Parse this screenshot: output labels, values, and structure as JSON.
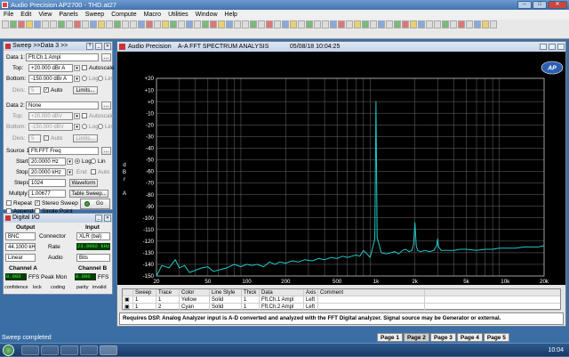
{
  "window": {
    "title": "Audio Precision AP2700 - THD.at27"
  },
  "menu": [
    "File",
    "Edit",
    "View",
    "Panels",
    "Sweep",
    "Compute",
    "Macro",
    "Utilities",
    "Window",
    "Help"
  ],
  "sweep_panel": {
    "title": "Sweep >>Data 3 >>",
    "data1": {
      "label": "Data 1:",
      "value": "Fft.Ch.1 Ampl",
      "top_label": "Top:",
      "top": "+20.000 dBr A",
      "autoscale": "Autoscale",
      "bottom_label": "Bottom:",
      "bottom": "-150.000 dBr A",
      "log": "Log",
      "lin": "Lin",
      "divs_label": "Divs:",
      "divs": "5",
      "auto": "Auto",
      "limits": "Limits..."
    },
    "data2": {
      "label": "Data 2:",
      "value": "None",
      "top_label": "Top:",
      "top": "+20.000 dBV",
      "autoscale": "Autoscale",
      "bottom_label": "Bottom:",
      "bottom": "-150.000 dBV",
      "log": "Log",
      "lin": "Lin",
      "divs_label": "Divs:",
      "divs": "5",
      "auto": "Auto",
      "limits": "Limits..."
    },
    "source1": {
      "label": "Source 1:",
      "value": "Fft.FFT Freq",
      "start_label": "Start:",
      "start": "20.0000 Hz",
      "log": "Log",
      "lin": "Lin",
      "stop_label": "Stop:",
      "stop": "20.0000 kHz",
      "end": "End",
      "auto": "Auto",
      "steps_label": "Steps:",
      "steps": "1024",
      "waveform": "Waveform",
      "multiply_label": "Multply:",
      "multiply": "1.00677",
      "table_sweep": "Table Sweep..."
    },
    "repeat": "Repeat",
    "stereo_sweep": "Stereo Sweep",
    "append": "Append",
    "single_point": "Single Point",
    "go": "Go"
  },
  "digital_io": {
    "title": "Digital I/O",
    "output_label": "Output",
    "input_label": "Input",
    "out_type": "BNC",
    "connector": "Connector",
    "in_type": "XLR (bal)",
    "out_rate": "44.1000 kHz",
    "rate": "Rate",
    "in_rate": "23.0002 kHz",
    "out_audio": "Linear",
    "audio": "Audio",
    "in_audio": "Bits",
    "chA_label": "Channel A",
    "chB_label": "Channel B",
    "chA_value": "0.000",
    "chA_unit": "FFS",
    "peak_mon": "Peak Mon",
    "chB_value": "0.000",
    "chB_unit": "FFS",
    "confidence": "confidence",
    "lock": "lock",
    "coding": "coding",
    "parity": "parity",
    "invalid": "invalid"
  },
  "graph": {
    "app": "Audio Precision",
    "title": "A-A FFT SPECTRUM ANALYSIS",
    "timestamp": "05/08/18 10:04:25",
    "logo": "AP",
    "yaxis_label": "dBr A"
  },
  "chart_data": {
    "type": "line",
    "title": "A-A FFT SPECTRUM ANALYSIS",
    "xlabel": "Hz",
    "ylabel": "dBr A",
    "xscale": "log",
    "xlim": [
      20,
      20000
    ],
    "ylim": [
      -150,
      20
    ],
    "xticks": [
      20,
      50,
      100,
      200,
      500,
      1000,
      2000,
      5000,
      10000,
      20000
    ],
    "xtick_labels": [
      "20",
      "50",
      "100",
      "200",
      "500",
      "1k",
      "2k",
      "5k",
      "10k",
      "20k"
    ],
    "yticks": [
      20,
      10,
      0,
      -10,
      -20,
      -30,
      -40,
      -50,
      -60,
      -70,
      -80,
      -90,
      -100,
      -110,
      -120,
      -130,
      -140,
      -150
    ],
    "ytick_labels": [
      "+20",
      "+10",
      "+0",
      "-10",
      "-20",
      "-30",
      "-40",
      "-50",
      "-60",
      "-70",
      "-80",
      "-90",
      "-100",
      "-110",
      "-120",
      "-130",
      "-140",
      "-150"
    ],
    "grid": true,
    "series": [
      {
        "color": "#20c8c8",
        "x": [
          20,
          22,
          25,
          28,
          30,
          33,
          36,
          40,
          45,
          50,
          55,
          60,
          70,
          80,
          90,
          100,
          110,
          120,
          135,
          150,
          165,
          180,
          200,
          225,
          250,
          280,
          320,
          360,
          400,
          450,
          500,
          550,
          600,
          650,
          700,
          750,
          800,
          850,
          900,
          950,
          980,
          1000,
          1020,
          1050,
          1100,
          1200,
          1300,
          1400,
          1500,
          1600,
          1700,
          1800,
          1900,
          1950,
          2000,
          2050,
          2100,
          2200,
          2400,
          2600,
          2800,
          2950,
          3000,
          3050,
          3200,
          3500,
          4000,
          4500,
          5000,
          6000,
          7000,
          8000,
          9000,
          10000,
          12000,
          14000,
          16000,
          18000,
          20000
        ],
        "y": [
          -150,
          -141,
          -143,
          -136,
          -143,
          -141,
          -147,
          -145,
          -143,
          -142,
          -146,
          -145,
          -143,
          -140,
          -142,
          -140,
          -141,
          -140,
          -142,
          -138,
          -140,
          -138,
          -139,
          -137,
          -138,
          -136,
          -137,
          -135,
          -136,
          -134,
          -135,
          -133,
          -134,
          -133,
          -132,
          -133,
          -128,
          -131,
          -134,
          -124,
          -118,
          0,
          -117,
          -122,
          -130,
          -131,
          -130,
          -129,
          -131,
          -128,
          -127,
          -129,
          -128,
          -123,
          -104,
          -124,
          -128,
          -129,
          -128,
          -129,
          -128,
          -124,
          -118,
          -125,
          -128,
          -128,
          -128,
          -127,
          -127,
          -128,
          -127,
          -127,
          -126,
          -126,
          -126,
          -125,
          -125,
          -125,
          -124
        ]
      }
    ]
  },
  "trace_table": {
    "headers": [
      "Sweep",
      "Trace",
      "Color",
      "Line Style",
      "Thick",
      "Data",
      "Axis",
      "Comment"
    ],
    "rows": [
      [
        "1",
        "1",
        "Yellow",
        "Solid",
        "1",
        "Fft.Ch.1 Ampl",
        "Left",
        ""
      ],
      [
        "1",
        "2",
        "Cyan",
        "Solid",
        "1",
        "Fft.Ch.2 Ampl",
        "Left",
        ""
      ]
    ]
  },
  "notes": "Requires DSP.  Analog Analyzer input is A-D converted and analyzed with the FFT Digital analyzer.  Signal source may be Generator or external.",
  "pages": [
    "Page 1",
    "Page 2",
    "Page 3",
    "Page 4",
    "Page 5"
  ],
  "status": "Sweep completed",
  "clock": "10:04"
}
